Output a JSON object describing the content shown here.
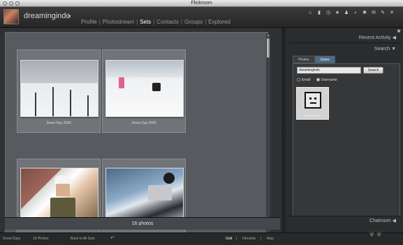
{
  "window": {
    "title": "Flickroom"
  },
  "header": {
    "username": "dreamingindc",
    "nav": [
      {
        "label": "Profile",
        "active": false
      },
      {
        "label": "Photostream",
        "active": false
      },
      {
        "label": "Sets",
        "active": true
      },
      {
        "label": "Contacts",
        "active": false
      },
      {
        "label": "Groups",
        "active": false
      },
      {
        "label": "Explored",
        "active": false
      }
    ],
    "icons": [
      "home-icon",
      "trash-icon",
      "clock-icon",
      "star-icon",
      "person-icon",
      "search-icon",
      "settings-icon",
      "mail-icon",
      "tools-icon",
      "close-icon"
    ]
  },
  "grid": {
    "tiles": [
      {
        "caption": "Snow Day 2009"
      },
      {
        "caption": "Snow Day 2009"
      },
      {
        "caption": ""
      },
      {
        "caption": ""
      }
    ],
    "count_label": "16 photos"
  },
  "right_panel": {
    "recent_activity": "Recent Activity",
    "search": "Search",
    "tabs": [
      {
        "label": "Photos",
        "active": false
      },
      {
        "label": "Users",
        "active": true
      }
    ],
    "query": "dreamingindc",
    "search_button": "Search",
    "radio_email": "Email",
    "radio_username": "Username",
    "result_name": "dreamingindc",
    "chatroom": "Chatroom"
  },
  "bottom": {
    "set_name": "Snow Days",
    "photo_count": "16 Photos",
    "back_link": "Back to All Sets",
    "views": [
      {
        "label": "Grid",
        "active": true
      },
      {
        "label": "Filmstrip",
        "active": false
      },
      {
        "label": "Map",
        "active": false
      }
    ]
  }
}
